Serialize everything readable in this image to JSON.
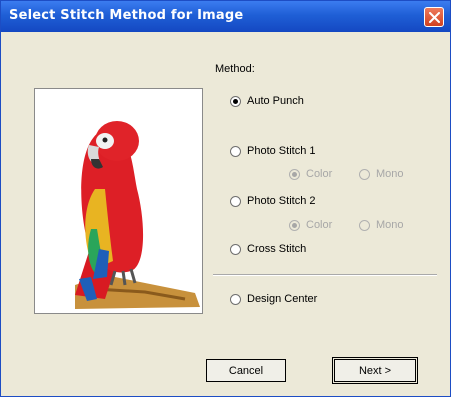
{
  "window": {
    "title": "Select Stitch Method for Image"
  },
  "labels": {
    "method": "Method:"
  },
  "options": {
    "auto_punch": "Auto Punch",
    "photo_stitch_1": "Photo Stitch 1",
    "photo_stitch_1_color": "Color",
    "photo_stitch_1_mono": "Mono",
    "photo_stitch_2": "Photo Stitch 2",
    "photo_stitch_2_color": "Color",
    "photo_stitch_2_mono": "Mono",
    "cross_stitch": "Cross Stitch",
    "design_center": "Design Center"
  },
  "selected_method": "Auto Punch",
  "buttons": {
    "cancel": "Cancel",
    "next": "Next >"
  },
  "colors": {
    "titlebar": "#1f5fd6",
    "dialog_bg": "#ece9d8",
    "close": "#d2411f"
  },
  "icons": {
    "close": "close-icon",
    "preview": "parrot-image"
  }
}
